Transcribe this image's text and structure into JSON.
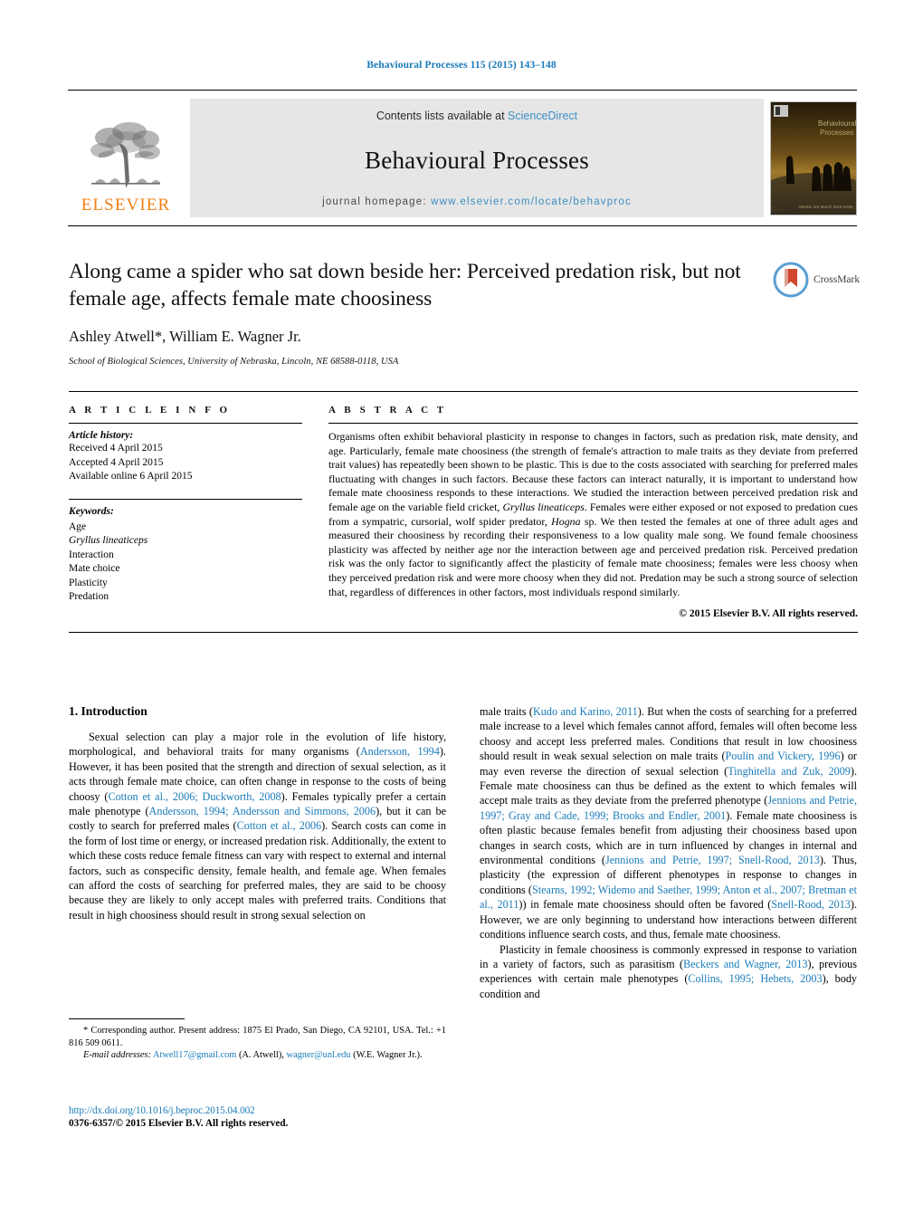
{
  "running_head": "Behavioural Processes 115 (2015) 143–148",
  "masthead": {
    "contents_prefix": "Contents lists available at ",
    "sciencedirect": "ScienceDirect",
    "journal_title": "Behavioural Processes",
    "homepage_prefix": "journal homepage: ",
    "homepage_url": "www.elsevier.com/locate/behavproc",
    "publisher": "ELSEVIER",
    "accent_link_color": "#3d8fc4",
    "elsevier_orange": "#f07f13"
  },
  "article": {
    "title": "Along came a spider who sat down beside her: Perceived predation risk, but not female age, affects female mate choosiness",
    "authors": "Ashley Atwell*, William E. Wagner Jr.",
    "affiliation": "School of Biological Sciences, University of Nebraska, Lincoln, NE 68588-0118, USA",
    "crossmark_label": "CrossMark"
  },
  "article_info": {
    "heading": "A R T I C L E   I N F O",
    "history_label": "Article history:",
    "history": [
      "Received 4 April 2015",
      "Accepted 4 April 2015",
      "Available online 6 April 2015"
    ],
    "keywords_label": "Keywords:",
    "keywords": [
      {
        "text": "Age",
        "italic": false
      },
      {
        "text": "Gryllus lineaticeps",
        "italic": true
      },
      {
        "text": "Interaction",
        "italic": false
      },
      {
        "text": "Mate choice",
        "italic": false
      },
      {
        "text": "Plasticity",
        "italic": false
      },
      {
        "text": "Predation",
        "italic": false
      }
    ]
  },
  "abstract": {
    "heading": "A B S T R A C T",
    "text_part_1": "Organisms often exhibit behavioral plasticity in response to changes in factors, such as predation risk, mate density, and age. Particularly, female mate choosiness (the strength of female's attraction to male traits as they deviate from preferred trait values) has repeatedly been shown to be plastic. This is due to the costs associated with searching for preferred males fluctuating with changes in such factors. Because these factors can interact naturally, it is important to understand how female mate choosiness responds to these interactions. We studied the interaction between perceived predation risk and female age on the variable field cricket, ",
    "species_1": "Gryllus lineaticeps",
    "text_part_2": ". Females were either exposed or not exposed to predation cues from a sympatric, cursorial, wolf spider predator, ",
    "species_2": "Hogna",
    "text_part_3": " sp. We then tested the females at one of three adult ages and measured their choosiness by recording their responsiveness to a low quality male song. We found female choosiness plasticity was affected by neither age nor the interaction between age and perceived predation risk. Perceived predation risk was the only factor to significantly affect the plasticity of female mate choosiness; females were less choosy when they perceived predation risk and were more choosy when they did not. Predation may be such a strong source of selection that, regardless of differences in other factors, most individuals respond similarly.",
    "copyright": "© 2015 Elsevier B.V. All rights reserved."
  },
  "introduction": {
    "section_number_title": "1.  Introduction",
    "left_para_1_a": "Sexual selection can play a major role in the evolution of life history, morphological, and behavioral traits for many organisms (",
    "left_ref_1": "Andersson, 1994",
    "left_para_1_b": "). However, it has been posited that the strength and direction of sexual selection, as it acts through female mate choice, can often change in response to the costs of being choosy (",
    "left_ref_2": "Cotton et al., 2006; Duckworth, 2008",
    "left_para_1_c": "). Females typically prefer a certain male phenotype (",
    "left_ref_3": "Andersson, 1994; Andersson and Simmons, 2006",
    "left_para_1_d": "), but it can be costly to search for preferred males (",
    "left_ref_4": "Cotton et al., 2006",
    "left_para_1_e": "). Search costs can come in the form of lost time or energy, or increased predation risk. Additionally, the extent to which these costs reduce female fitness can vary with respect to external and internal factors, such as conspecific density, female health, and female age. When females can afford the costs of searching for preferred males, they are said to be choosy because they are likely to only accept males with preferred traits. Conditions that result in high choosiness should result in strong sexual selection on",
    "right_para_1_a": "male traits (",
    "right_ref_1": "Kudo and Karino, 2011",
    "right_para_1_b": "). But when the costs of searching for a preferred male increase to a level which females cannot afford, females will often become less choosy and accept less preferred males. Conditions that result in low choosiness should result in weak sexual selection on male traits (",
    "right_ref_2": "Poulin and Vickery, 1996",
    "right_para_1_c": ") or may even reverse the direction of sexual selection (",
    "right_ref_3": "Tinghitella and Zuk, 2009",
    "right_para_1_d": "). Female mate choosiness can thus be defined as the extent to which females will accept male traits as they deviate from the preferred phenotype (",
    "right_ref_4": "Jennions and Petrie, 1997; Gray and Cade, 1999; Brooks and Endler, 2001",
    "right_para_1_e": "). Female mate choosiness is often plastic because females benefit from adjusting their choosiness based upon changes in search costs, which are in turn influenced by changes in internal and environmental conditions (",
    "right_ref_5": "Jennions and Petrie, 1997; Snell-Rood, 2013",
    "right_para_1_f": "). Thus, plasticity (the expression of different phenotypes in response to changes in conditions (",
    "right_ref_6": "Stearns, 1992; Widemo and Saether, 1999; Anton et al., 2007; Bretman et al., 2011",
    "right_para_1_g": ")) in female mate choosiness should often be favored (",
    "right_ref_7": "Snell-Rood, 2013",
    "right_para_1_h": "). However, we are only beginning to understand how interactions between different conditions influence search costs, and thus, female mate choosiness.",
    "right_para_2_a": "Plasticity in female choosiness is commonly expressed in response to variation in a variety of factors, such as parasitism (",
    "right_ref_8": "Beckers and Wagner, 2013",
    "right_para_2_b": "), previous experiences with certain male phenotypes (",
    "right_ref_9": "Collins, 1995; Hebets, 2003",
    "right_para_2_c": "), body condition and"
  },
  "footnotes": {
    "corresponding_a": "* Corresponding author. Present address: 1875 El Prado, San Diego, CA 92101, USA. Tel.: +1 816 509 0611.",
    "email_label": "E-mail addresses:",
    "email_1": "Atwell17@gmail.com",
    "email_1_owner": " (A. Atwell), ",
    "email_2": "wagner@unl.edu",
    "email_2_owner": " (W.E. Wagner Jr.).",
    "doi": "http://dx.doi.org/10.1016/j.beproc.2015.04.002",
    "issn_copyright": "0376-6357/© 2015 Elsevier B.V. All rights reserved."
  }
}
